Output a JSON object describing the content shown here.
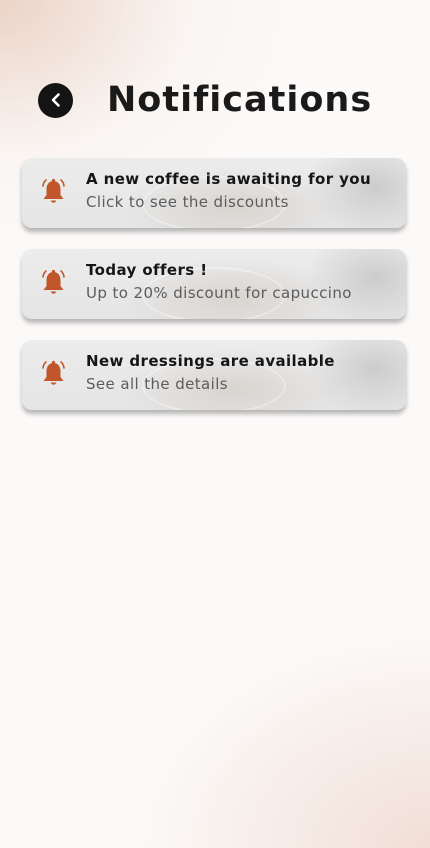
{
  "header": {
    "title": "Notifications",
    "back_icon": "chevron-left-icon"
  },
  "colors": {
    "accent": "#c0562a",
    "dark": "#141414"
  },
  "notifications": [
    {
      "icon": "bell-icon",
      "title": "A new coffee is awaiting for you",
      "subtitle": "Click to see the discounts"
    },
    {
      "icon": "bell-icon",
      "title": "Today offers !",
      "subtitle": "Up to 20% discount for capuccino"
    },
    {
      "icon": "bell-icon",
      "title": "New dressings are available",
      "subtitle": "See all the details"
    }
  ]
}
